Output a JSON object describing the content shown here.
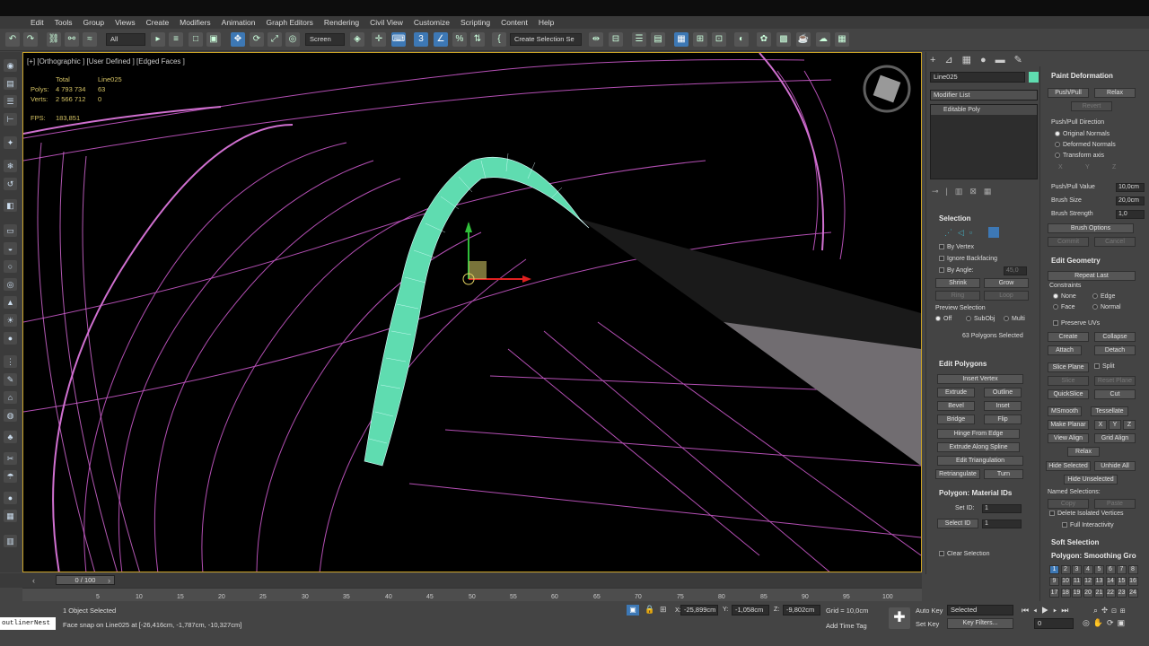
{
  "menu": [
    "Edit",
    "Tools",
    "Group",
    "Views",
    "Create",
    "Modifiers",
    "Animation",
    "Graph Editors",
    "Rendering",
    "Civil View",
    "Customize",
    "Scripting",
    "Content",
    "Help"
  ],
  "toolbar": {
    "filter": "All",
    "ref_coord": "Screen",
    "selection_set": "Create Selection Se",
    "snap_label": "3"
  },
  "viewport": {
    "label": "[+] [Orthographic ] [User Defined ] [Edged Faces ]",
    "stats": {
      "col_total": "Total",
      "col_obj": "Line025",
      "polys_label": "Polys:",
      "polys_total": "4 793 734",
      "polys_obj": "63",
      "verts_label": "Verts:",
      "verts_total": "2 566 712",
      "verts_obj": "0",
      "fps_label": "FPS:",
      "fps_value": "183,851"
    }
  },
  "timeline": {
    "slider": "0 / 100",
    "ticks": [
      "5",
      "10",
      "15",
      "20",
      "25",
      "30",
      "35",
      "40",
      "45",
      "50",
      "55",
      "60",
      "65",
      "70",
      "75",
      "80",
      "85",
      "90",
      "95",
      "100"
    ]
  },
  "status": {
    "script_field": "outlinerNest",
    "selected": "1 Object Selected",
    "prompt": "Face snap on Line025 at [-26,416cm, -1,787cm, -10,327cm]",
    "x_label": "X:",
    "x": "-25,899cm",
    "y_label": "Y:",
    "y": "-1,058cm",
    "z_label": "Z:",
    "z": "-9,802cm",
    "grid": "Grid = 10,0cm",
    "add_time_tag": "Add Time Tag",
    "auto_key": "Auto Key",
    "set_key": "Set Key",
    "key_mode": "Selected",
    "key_filters": "Key Filters...",
    "frame": "0"
  },
  "command_panel": {
    "object_name": "Line025",
    "modifier_list": "Modifier List",
    "stack_item": "Editable Poly",
    "selection": {
      "title": "Selection",
      "by_vertex": "By Vertex",
      "ignore_backfacing": "Ignore Backfacing",
      "by_angle": "By Angle:",
      "by_angle_value": "45,0",
      "shrink": "Shrink",
      "grow": "Grow",
      "ring": "Ring",
      "loop": "Loop",
      "preview": "Preview Selection",
      "off": "Off",
      "subobj": "SubObj",
      "multi": "Multi",
      "status": "63 Polygons Selected"
    },
    "edit_polygons": {
      "title": "Edit Polygons",
      "insert_vertex": "Insert Vertex",
      "extrude": "Extrude",
      "outline": "Outline",
      "bevel": "Bevel",
      "inset": "Inset",
      "bridge": "Bridge",
      "flip": "Flip",
      "hinge": "Hinge From Edge",
      "extrude_spline": "Extrude Along Spline",
      "edit_tri": "Edit Triangulation",
      "retriangulate": "Retriangulate",
      "turn": "Turn"
    },
    "material_ids": {
      "title": "Polygon: Material IDs",
      "set_id": "Set ID:",
      "select_id": "Select ID",
      "set_value": "1",
      "select_value": "1",
      "clear_selection": "Clear Selection"
    }
  },
  "roll_panel": {
    "paint_title": "Paint Deformation",
    "push_pull": "Push/Pull",
    "relax": "Relax",
    "revert": "Revert",
    "direction": "Push/Pull Direction",
    "orig_normals": "Original Normals",
    "deformed_normals": "Deformed Normals",
    "transform_axis": "Transform axis",
    "ax_x": "X",
    "ax_y": "Y",
    "ax_z": "Z",
    "pp_value_label": "Push/Pull Value",
    "pp_value": "10,0cm",
    "brush_size_label": "Brush Size",
    "brush_size": "20,0cm",
    "brush_strength_label": "Brush Strength",
    "brush_strength": "1,0",
    "brush_options": "Brush Options",
    "commit": "Commit",
    "cancel": "Cancel",
    "edit_geo_title": "Edit Geometry",
    "repeat_last": "Repeat Last",
    "constraints": "Constraints",
    "c_none": "None",
    "c_edge": "Edge",
    "c_face": "Face",
    "c_normal": "Normal",
    "preserve_uvs": "Preserve UVs",
    "create": "Create",
    "collapse": "Collapse",
    "attach": "Attach",
    "detach": "Detach",
    "slice_plane": "Slice Plane",
    "split": "Split",
    "slice": "Slice",
    "reset_plane": "Reset Plane",
    "quickslice": "QuickSlice",
    "cut": "Cut",
    "msmooth": "MSmooth",
    "tessellate": "Tessellate",
    "make_planar": "Make Planar",
    "mp_x": "X",
    "mp_y": "Y",
    "mp_z": "Z",
    "view_align": "View Align",
    "grid_align": "Grid Align",
    "relax2": "Relax",
    "hide_selected": "Hide Selected",
    "unhide_all": "Unhide All",
    "hide_unselected": "Hide Unselected",
    "named_sel": "Named Selections:",
    "copy": "Copy",
    "paste": "Paste",
    "delete_isolated": "Delete Isolated Vertices",
    "full_interactivity": "Full Interactivity",
    "soft_sel": "Soft Selection",
    "smoothing": "Polygon: Smoothing Gro",
    "sg_numbers": [
      "1",
      "2",
      "3",
      "4",
      "5",
      "6",
      "7",
      "8",
      "9",
      "10",
      "11",
      "12",
      "13",
      "14",
      "15",
      "16",
      "17",
      "18",
      "19",
      "20",
      "21",
      "22",
      "23",
      "24"
    ]
  },
  "colors": {
    "accent": "#3d78b5",
    "tube": "#5fdcb0",
    "wire": "#c858c8",
    "stats": "#d4c264"
  }
}
